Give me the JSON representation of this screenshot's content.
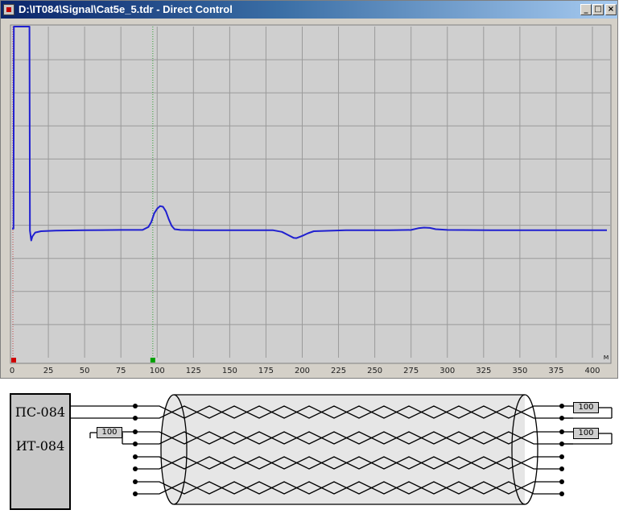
{
  "window": {
    "title": "D:\\IT084\\Signal\\Cat5e_5.tdr - Direct Control",
    "buttons": {
      "minimize": "_",
      "maximize": "□",
      "close": "×"
    }
  },
  "chart_data": {
    "type": "line",
    "title": "",
    "xlabel": "",
    "ylabel": "",
    "x_unit": "м",
    "xlim": [
      0,
      410
    ],
    "ylim": [
      0,
      1
    ],
    "x_ticks": [
      0,
      25,
      50,
      75,
      100,
      125,
      150,
      175,
      200,
      225,
      250,
      275,
      300,
      325,
      350,
      375,
      400
    ],
    "grid": true,
    "line_color": "#2020d0",
    "cursor_marker_x": 97,
    "series": [
      {
        "x": [
          0,
          1,
          1.2,
          12,
          12.3,
          13.2,
          14,
          16,
          20,
          30,
          50,
          75,
          90,
          94,
          96,
          98,
          100,
          102,
          104,
          106,
          108,
          110,
          112,
          116,
          130,
          150,
          180,
          186,
          190,
          194,
          196,
          200,
          204,
          208,
          230,
          260,
          275,
          280,
          284,
          288,
          292,
          300,
          330,
          360,
          390,
          410
        ],
        "y": [
          0.39,
          0.39,
          1.0,
          1.0,
          0.384,
          0.354,
          0.366,
          0.378,
          0.382,
          0.384,
          0.385,
          0.386,
          0.386,
          0.395,
          0.41,
          0.436,
          0.45,
          0.458,
          0.456,
          0.442,
          0.418,
          0.398,
          0.388,
          0.386,
          0.385,
          0.385,
          0.385,
          0.38,
          0.371,
          0.362,
          0.361,
          0.368,
          0.376,
          0.382,
          0.385,
          0.385,
          0.386,
          0.391,
          0.393,
          0.392,
          0.388,
          0.386,
          0.385,
          0.385,
          0.385,
          0.385
        ]
      }
    ]
  },
  "diagram": {
    "pc_label": "ПС-084",
    "it_label": "ИТ-084",
    "resistor_value": "100"
  }
}
